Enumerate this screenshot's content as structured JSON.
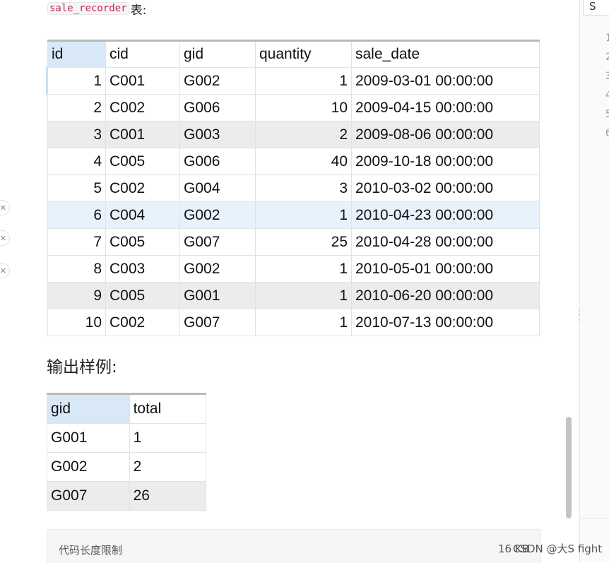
{
  "intro": {
    "code": "sale_recorder",
    "suffix": "表:"
  },
  "sale_table": {
    "headers": [
      "id",
      "cid",
      "gid",
      "quantity",
      "sale_date"
    ],
    "rows": [
      [
        "1",
        "C001",
        "G002",
        "1",
        "2009-03-01 00:00:00"
      ],
      [
        "2",
        "C002",
        "G006",
        "10",
        "2009-04-15 00:00:00"
      ],
      [
        "3",
        "C001",
        "G003",
        "2",
        "2009-08-06 00:00:00"
      ],
      [
        "4",
        "C005",
        "G006",
        "40",
        "2009-10-18 00:00:00"
      ],
      [
        "5",
        "C002",
        "G004",
        "3",
        "2010-03-02 00:00:00"
      ],
      [
        "6",
        "C004",
        "G002",
        "1",
        "2010-04-23 00:00:00"
      ],
      [
        "7",
        "C005",
        "G007",
        "25",
        "2010-04-28 00:00:00"
      ],
      [
        "8",
        "C003",
        "G002",
        "1",
        "2010-05-01 00:00:00"
      ],
      [
        "9",
        "C005",
        "G001",
        "1",
        "2010-06-20 00:00:00"
      ],
      [
        "10",
        "C002",
        "G007",
        "1",
        "2010-07-13 00:00:00"
      ]
    ]
  },
  "output_heading": "输出样例:",
  "output_table": {
    "headers": [
      "gid",
      "total"
    ],
    "rows": [
      [
        "G001",
        "1"
      ],
      [
        "G002",
        "2"
      ],
      [
        "G007",
        "26"
      ]
    ]
  },
  "bottom_bar": {
    "label": "代码长度限制",
    "size": "16 KB"
  },
  "right_pane": {
    "top_label": "S",
    "line_numbers": [
      "1",
      "2",
      "3",
      "4",
      "5",
      "6"
    ]
  },
  "watermark": "CSDN @大S fight",
  "colors": {
    "header_highlight": "#d9e8f7",
    "stripe": "#ececec",
    "selected_row": "#e8f2fc",
    "code_text": "#c7254e"
  }
}
